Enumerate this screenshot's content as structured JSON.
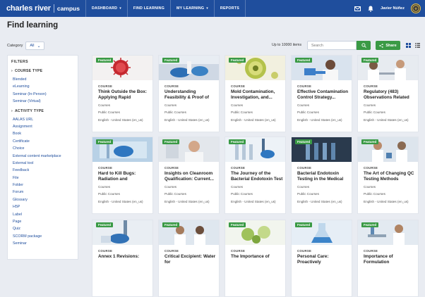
{
  "header": {
    "logo_main": "charles river",
    "logo_sub": "campus",
    "nav": [
      {
        "label": "DASHBOARD",
        "dropdown": true
      },
      {
        "label": "FIND LEARNING",
        "dropdown": false
      },
      {
        "label": "MY LEARNING",
        "dropdown": true
      },
      {
        "label": "REPORTS",
        "dropdown": false
      }
    ],
    "user_name": "Javier Núñez",
    "icons": [
      "mail-icon",
      "bell-icon"
    ]
  },
  "page": {
    "title": "Find learning"
  },
  "toolbar": {
    "category_label": "Category",
    "category_value": "All",
    "items_count": "Up to 10000 items",
    "search_placeholder": "Search",
    "share_label": "Share"
  },
  "filters": {
    "title": "FILTERS",
    "groups": [
      {
        "label": "COURSE TYPE",
        "items": [
          "Blended",
          "eLearning",
          "Seminar (In-Person)",
          "Seminar (Virtual)"
        ]
      },
      {
        "label": "ACTIVITY TYPE",
        "items": [
          "AALAS URL",
          "Assignment",
          "Book",
          "Certificate",
          "Choice",
          "External content marketplace",
          "External tool",
          "Feedback",
          "File",
          "Folder",
          "Forum",
          "Glossary",
          "H5P",
          "Label",
          "Page",
          "Quiz",
          "SCORM package",
          "Seminar"
        ]
      }
    ]
  },
  "cards": [
    {
      "badge": "Featured",
      "type": "COURSE",
      "title": "Think Outside the Box: Applying Rapid Sterility...",
      "meta1": "Courses",
      "meta2": "Public Courses",
      "meta3": "English - United States (en_us)",
      "image": "virus"
    },
    {
      "badge": "Featured",
      "type": "COURSE",
      "title": "Understanding Feasibility & Proof of Concept Tests...",
      "meta1": "Courses",
      "meta2": "Public Courses",
      "meta3": "English - United States (en_us)",
      "image": "lab-hands"
    },
    {
      "badge": "Featured",
      "type": "COURSE",
      "title": "Mold Contamination, Investigation, and...",
      "meta1": "Courses",
      "meta2": "Public Courses",
      "meta3": "English - United States (en_us)",
      "image": "mold"
    },
    {
      "badge": "Featured",
      "type": "COURSE",
      "title": "Effective Contamination Control Strategy...",
      "meta1": "Courses",
      "meta2": "Public Courses",
      "meta3": "English - United States (en_us)",
      "image": "scientist-gloves"
    },
    {
      "badge": "Featured",
      "type": "COURSE",
      "title": "Regulatory (483) Observations Related to...",
      "meta1": "Courses",
      "meta2": "Public Courses",
      "meta3": "English - United States (en_us)",
      "image": "lab-team"
    },
    {
      "badge": "Featured",
      "type": "COURSE",
      "title": "Hard to Kill Bugs: Radiation and Disinfectant...",
      "meta1": "Courses",
      "meta2": "Public Courses",
      "meta3": "English - United States (en_us)",
      "image": "cleanroom-glove"
    },
    {
      "badge": "Featured",
      "type": "COURSE",
      "title": "Insights on Cleanroom Qualification: Current...",
      "meta1": "Courses",
      "meta2": "Public Courses",
      "meta3": "English - United States (en_us)",
      "image": "man-portrait"
    },
    {
      "badge": "Featured",
      "type": "COURSE",
      "title": "The Journey of the Bacterial Endotoxin Test",
      "meta1": "Courses",
      "meta2": "Public Courses",
      "meta3": "English - United States (en_us)",
      "image": "pipette-tubes"
    },
    {
      "badge": "Featured",
      "type": "COURSE",
      "title": "Bacterial Endotoxin Testing in the Medical Device...",
      "meta1": "Courses",
      "meta2": "Public Courses",
      "meta3": "English - United States (en_us)",
      "image": "vials-dark"
    },
    {
      "badge": "Featured",
      "type": "COURSE",
      "title": "The Art of Changing QC Testing Methods",
      "meta1": "Courses",
      "meta2": "Public Courses",
      "meta3": "English - United States (en_us)",
      "image": "lab-workers"
    },
    {
      "badge": "Featured",
      "type": "COURSE",
      "title": "Annex 1 Revisions:",
      "meta1": "",
      "meta2": "",
      "meta3": "",
      "image": "pipette-lab"
    },
    {
      "badge": "Featured",
      "type": "COURSE",
      "title": "Critical Excipient: Water for",
      "meta1": "",
      "meta2": "",
      "meta3": "",
      "image": "lab-pair"
    },
    {
      "badge": "Featured",
      "type": "COURSE",
      "title": "The Importance of",
      "meta1": "",
      "meta2": "",
      "meta3": "",
      "image": "plates-green"
    },
    {
      "badge": "Featured",
      "type": "COURSE",
      "title": "Personal Care: Proactively",
      "meta1": "",
      "meta2": "",
      "meta3": "",
      "image": "flask-blue"
    },
    {
      "badge": "Featured",
      "type": "COURSE",
      "title": "Importance of Formulation",
      "meta1": "",
      "meta2": "",
      "meta3": "",
      "image": "lab-bench"
    }
  ],
  "colors": {
    "topbar": "#1f4e9d",
    "accent_green": "#3a9a45",
    "link_blue": "#1f4e9d",
    "page_bg": "#e9ecf2"
  }
}
